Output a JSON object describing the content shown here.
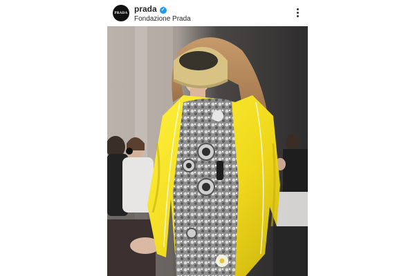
{
  "post": {
    "avatar_text": "PRADA",
    "username": "prada",
    "verified_icon": "check-badge-icon",
    "location": "Fondazione Prada",
    "more_icon": "more-vertical-icon"
  },
  "photo": {
    "description_icon": "runway-photo",
    "colors": {
      "jacket": "#f2e01e",
      "visor": "#d9c58b",
      "dress": "#9a9a9a",
      "backdrop": "#9b9590"
    }
  }
}
